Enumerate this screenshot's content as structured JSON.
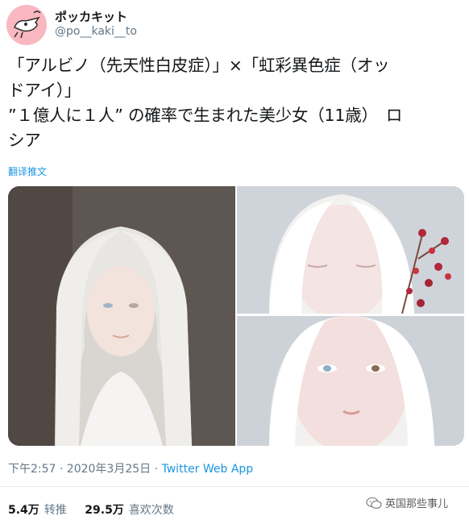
{
  "user": {
    "display_name": "ポッカキット",
    "handle": "@po__kaki__to"
  },
  "tweet": {
    "lines": [
      "「アルビノ（先天性白皮症）」×「虹彩異色症（オッ",
      "ドアイ）」",
      "”１億人に１人” の確率で生まれた美少女（11歳）　ロ",
      "シア"
    ],
    "translate_label": "翻译推文"
  },
  "meta": {
    "timestamp": "下午2:57 · 2020年3月25日 · ",
    "app": "Twitter Web App"
  },
  "stats": {
    "retweets_count": "5.4万",
    "retweets_label": "转推",
    "likes_count": "29.5万",
    "likes_label": "喜欢次数"
  },
  "watermark": {
    "text": "英国那些事儿"
  },
  "colors": {
    "link": "#1b95e0",
    "secondary_text": "#657786",
    "avatar_bg": "#f9b8bf"
  }
}
